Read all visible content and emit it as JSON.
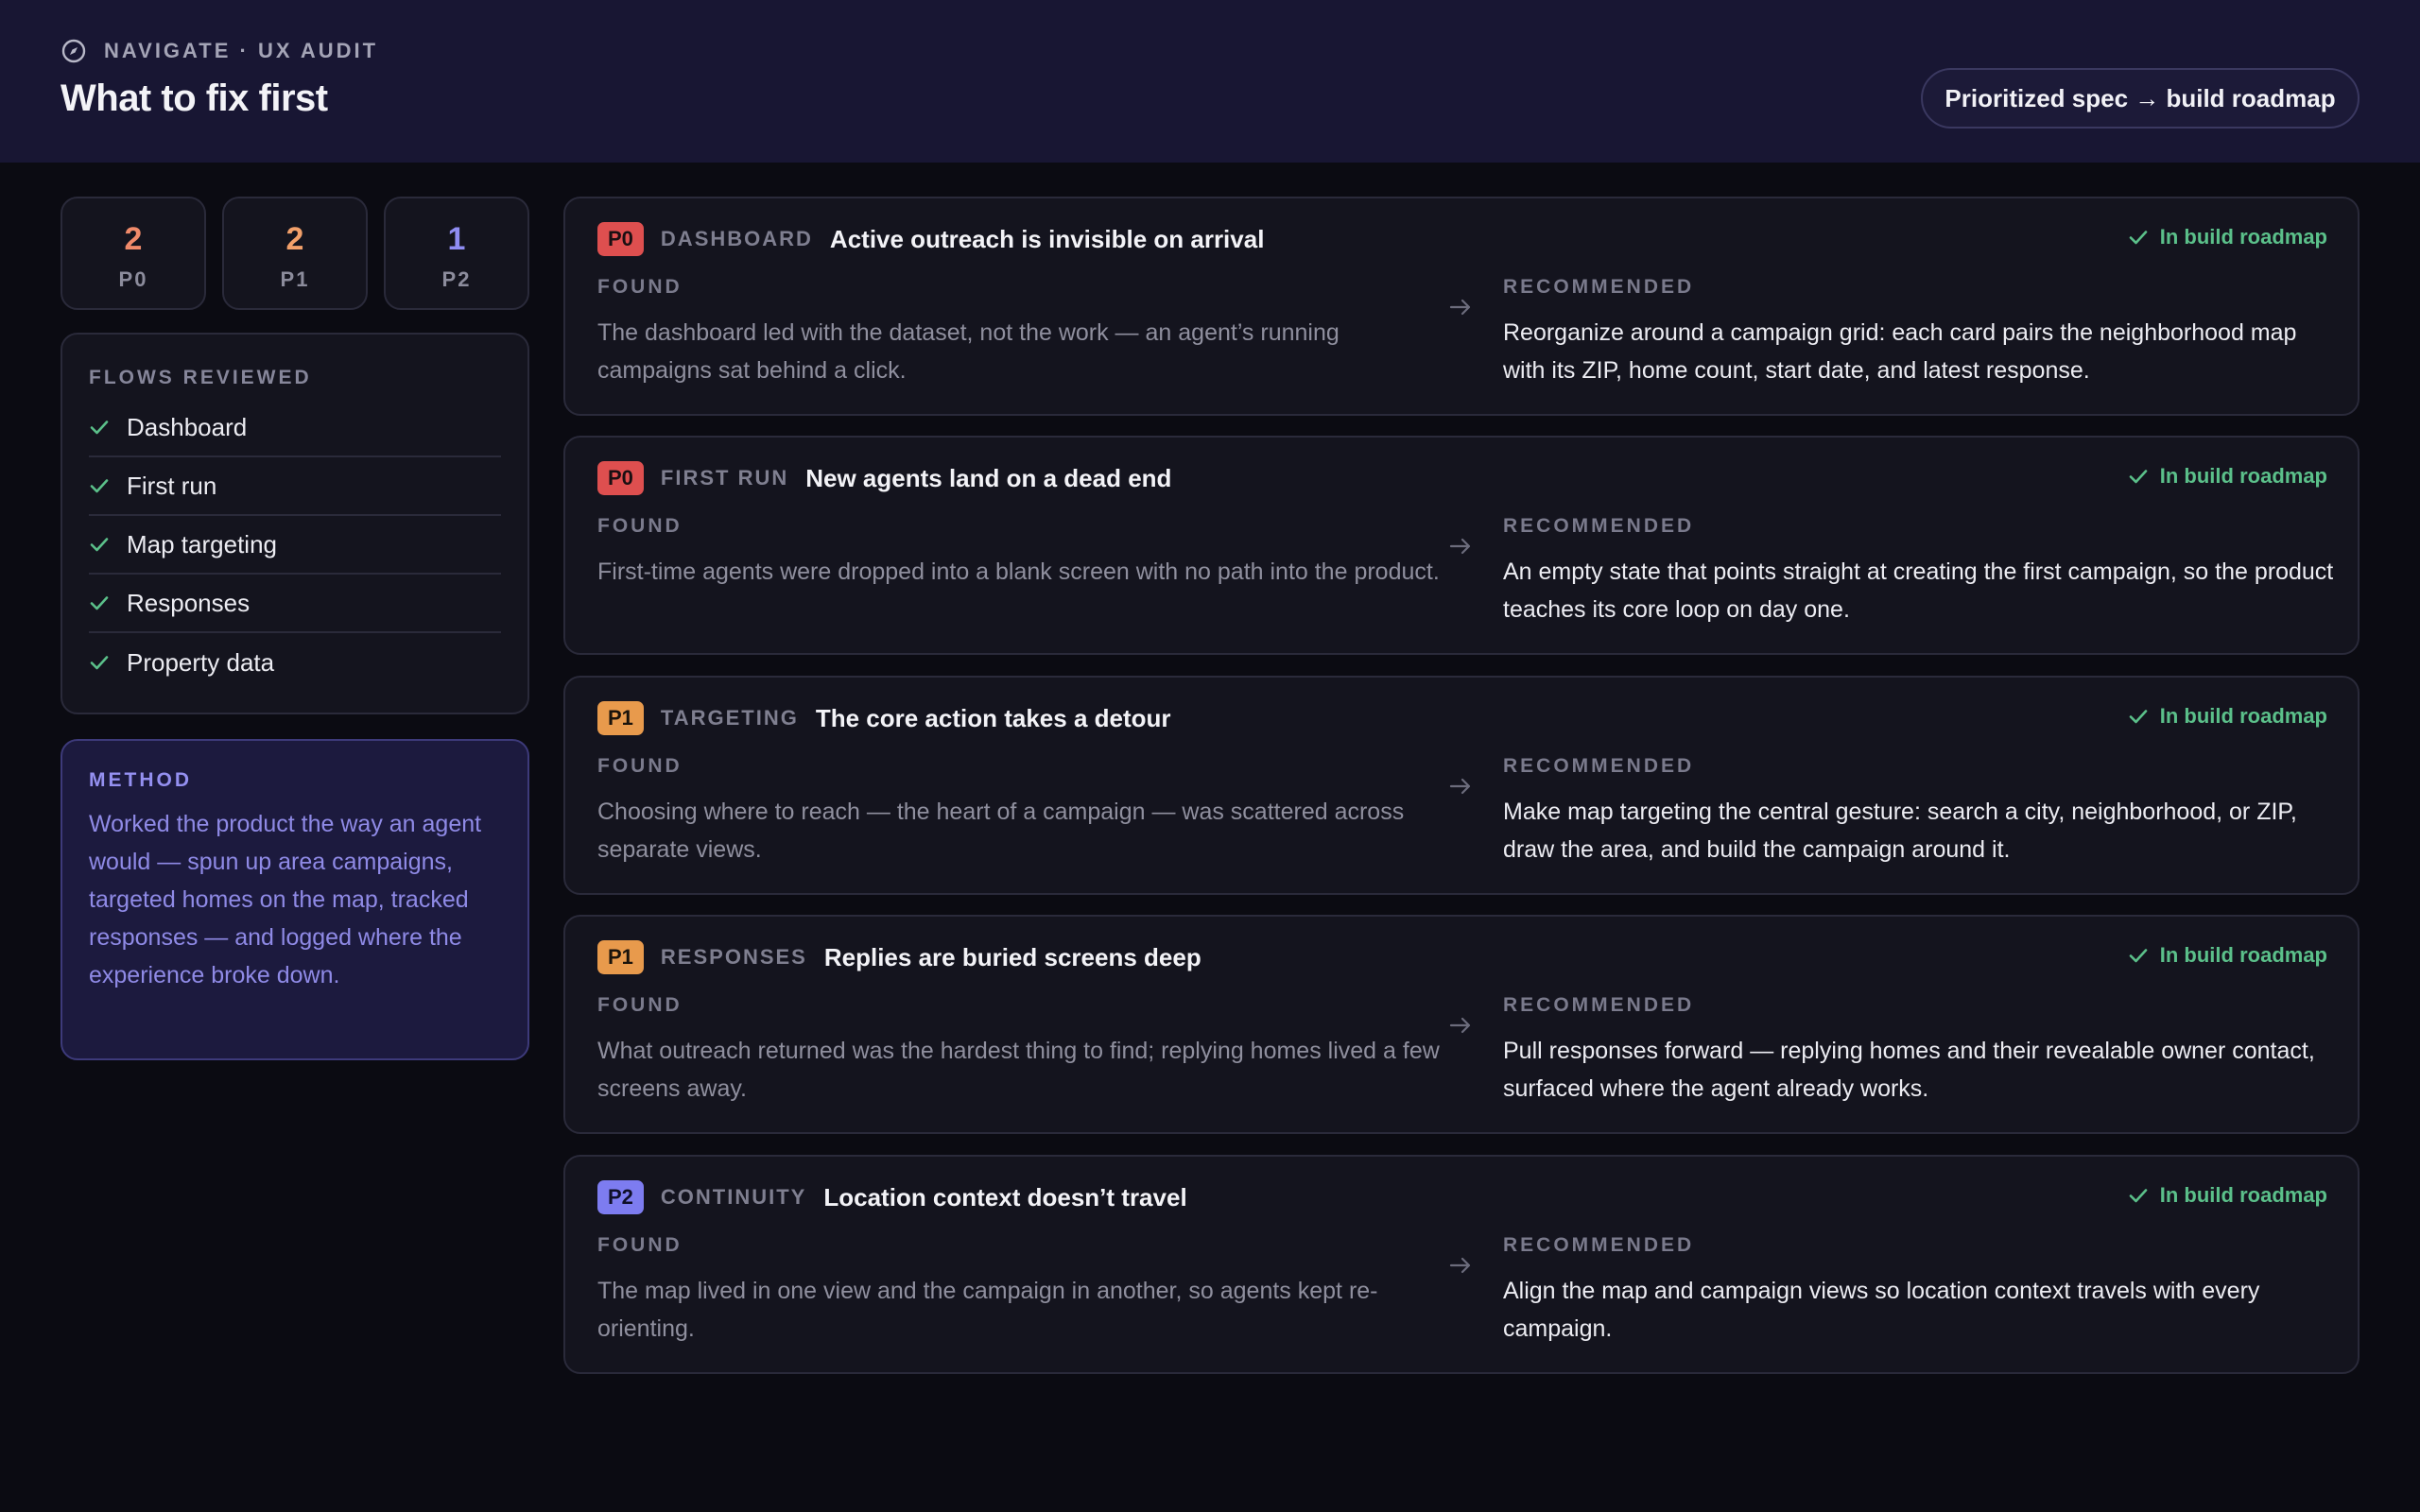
{
  "header": {
    "eyebrow": "NAVIGATE · UX AUDIT",
    "title": "What to fix first",
    "action_label": "Prioritized spec → build roadmap"
  },
  "stats": [
    {
      "count": "2",
      "label": "P0",
      "color": "#f08a6a"
    },
    {
      "count": "2",
      "label": "P1",
      "color": "#f2a06a"
    },
    {
      "count": "1",
      "label": "P2",
      "color": "#8f8cf2"
    }
  ],
  "flows": {
    "label": "FLOWS REVIEWED",
    "items": [
      {
        "label": "Dashboard"
      },
      {
        "label": "First run"
      },
      {
        "label": "Map targeting"
      },
      {
        "label": "Responses"
      },
      {
        "label": "Property data"
      }
    ]
  },
  "method": {
    "label": "METHOD",
    "body": "Worked the product the way an agent would — spun up area campaigns, targeted homes on the map, tracked responses — and logged where the experience broke down."
  },
  "labels": {
    "found": "FOUND",
    "recommended": "RECOMMENDED",
    "status": "In build roadmap"
  },
  "colors": {
    "P0": {
      "bg": "#de4f4f",
      "fg": "#1a0f12"
    },
    "P1": {
      "bg": "#e89a4c",
      "fg": "#1a130b"
    },
    "P2": {
      "bg": "#7d7cf0",
      "fg": "#0f0f28"
    },
    "status": "#5bc08a",
    "header_bg": "#181633"
  },
  "findings": [
    {
      "priority": "P0",
      "category": "DASHBOARD",
      "title": "Active outreach is invisible on arrival",
      "found": "The dashboard led with the dataset, not the work — an agent’s running campaigns sat behind a click.",
      "recommended": "Reorganize around a campaign grid: each card pairs the neighborhood map with its ZIP, home count, start date, and latest response."
    },
    {
      "priority": "P0",
      "category": "FIRST RUN",
      "title": "New agents land on a dead end",
      "found": "First-time agents were dropped into a blank screen with no path into the product.",
      "recommended": "An empty state that points straight at creating the first campaign, so the product teaches its core loop on day one."
    },
    {
      "priority": "P1",
      "category": "TARGETING",
      "title": "The core action takes a detour",
      "found": "Choosing where to reach — the heart of a campaign — was scattered across separate views.",
      "recommended": "Make map targeting the central gesture: search a city, neighborhood, or ZIP, draw the area, and build the campaign around it."
    },
    {
      "priority": "P1",
      "category": "RESPONSES",
      "title": "Replies are buried screens deep",
      "found": "What outreach returned was the hardest thing to find; replying homes lived a few screens away.",
      "recommended": "Pull responses forward — replying homes and their revealable owner contact, surfaced where the agent already works."
    },
    {
      "priority": "P2",
      "category": "CONTINUITY",
      "title": "Location context doesn’t travel",
      "found": "The map lived in one view and the campaign in another, so agents kept re-orienting.",
      "recommended": "Align the map and campaign views so location context travels with every campaign."
    }
  ]
}
